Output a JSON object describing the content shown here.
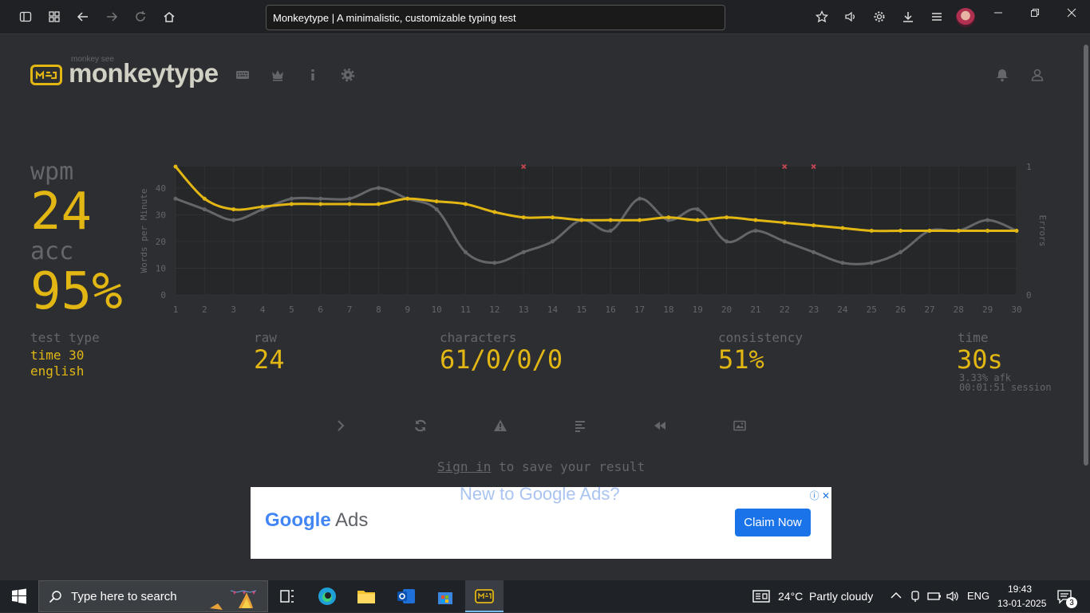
{
  "browser": {
    "tab_title": "Monkeytype | A minimalistic, customizable typing test"
  },
  "header": {
    "logo_sub": "monkey see",
    "logo_text": "monkeytype"
  },
  "result": {
    "wpm_label": "wpm",
    "wpm": "24",
    "acc_label": "acc",
    "acc": "95%",
    "test_type_label": "test type",
    "test_type_mode": "time 30",
    "test_type_lang": "english",
    "raw_label": "raw",
    "raw": "24",
    "characters_label": "characters",
    "characters": "61/0/0/0",
    "consistency_label": "consistency",
    "consistency": "51%",
    "time_label": "time",
    "time": "30s",
    "afk": "3.33% afk",
    "session": "00:01:51 session"
  },
  "signin": {
    "link": "Sign in",
    "rest": " to save your result"
  },
  "ad": {
    "headline": "New to Google Ads?",
    "brand_google": "Google",
    "brand_ads": " Ads",
    "cta": "Claim Now"
  },
  "taskbar": {
    "search_placeholder": "Type here to search",
    "weather": "24°C  Partly cloudy",
    "lang": "ENG",
    "time": "19:43",
    "date": "13-01-2025",
    "notifications": "3"
  },
  "chart_data": {
    "type": "line",
    "ylabel": "Words per Minute",
    "y2label": "Errors",
    "ylim": [
      0,
      48
    ],
    "yticks": [
      0,
      10,
      20,
      30,
      40
    ],
    "y2ticks": [
      0,
      1
    ],
    "x": [
      1,
      2,
      3,
      4,
      5,
      6,
      7,
      8,
      9,
      10,
      11,
      12,
      13,
      14,
      15,
      16,
      17,
      18,
      19,
      20,
      21,
      22,
      23,
      24,
      25,
      26,
      27,
      28,
      29,
      30
    ],
    "series": [
      {
        "name": "wpm",
        "color": "#e2b714",
        "values": [
          48,
          36,
          32,
          33,
          34,
          34,
          34,
          34,
          36,
          35,
          34,
          31,
          29,
          29,
          28,
          28,
          28,
          29,
          28,
          29,
          28,
          27,
          26,
          25,
          24,
          24,
          24,
          24,
          24,
          24
        ]
      },
      {
        "name": "raw",
        "color": "#646669",
        "values": [
          36,
          32,
          28,
          32,
          36,
          36,
          36,
          40,
          36,
          32,
          16,
          12,
          16,
          20,
          28,
          24,
          36,
          28,
          32,
          20,
          24,
          20,
          16,
          12,
          12,
          16,
          24,
          24,
          28,
          24
        ]
      }
    ],
    "errors_at": [
      13,
      22,
      23
    ],
    "grid": true,
    "colors": {
      "accent": "#e2b714",
      "sub": "#646669",
      "error": "#ca4754",
      "bg": "#2c2e31"
    }
  }
}
